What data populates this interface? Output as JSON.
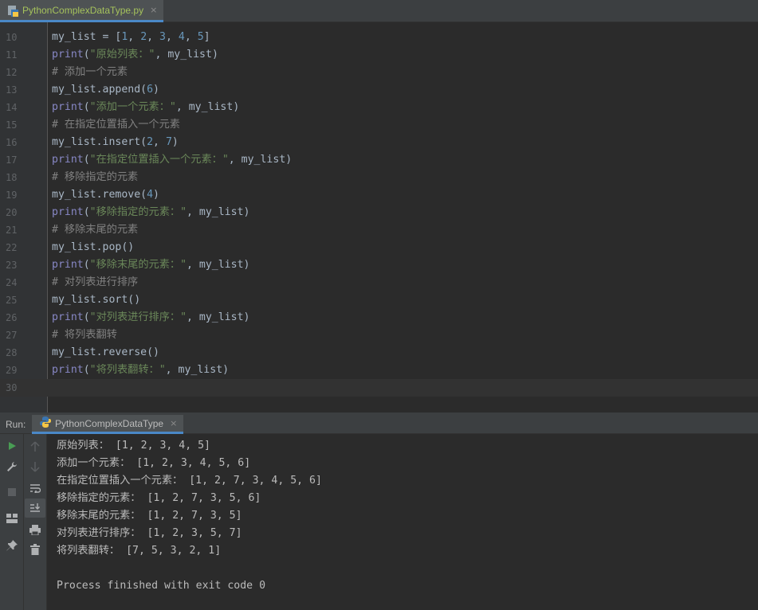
{
  "editor_tab": {
    "label": "PythonComplexDataType.py",
    "close": "×"
  },
  "code_lines": [
    {
      "num": "10",
      "tokens": [
        [
          "t",
          "my_list = ["
        ],
        [
          "n",
          "1"
        ],
        [
          "t",
          ", "
        ],
        [
          "n",
          "2"
        ],
        [
          "t",
          ", "
        ],
        [
          "n",
          "3"
        ],
        [
          "t",
          ", "
        ],
        [
          "n",
          "4"
        ],
        [
          "t",
          ", "
        ],
        [
          "n",
          "5"
        ],
        [
          "t",
          "]"
        ]
      ]
    },
    {
      "num": "11",
      "tokens": [
        [
          "k",
          "print"
        ],
        [
          "t",
          "("
        ],
        [
          "s",
          "\"原始列表：\""
        ],
        [
          "t",
          ", my_list)"
        ]
      ]
    },
    {
      "num": "12",
      "tokens": [
        [
          "c",
          "# 添加一个元素"
        ]
      ]
    },
    {
      "num": "13",
      "tokens": [
        [
          "t",
          "my_list.append("
        ],
        [
          "n",
          "6"
        ],
        [
          "t",
          ")"
        ]
      ]
    },
    {
      "num": "14",
      "tokens": [
        [
          "k",
          "print"
        ],
        [
          "t",
          "("
        ],
        [
          "s",
          "\"添加一个元素：\""
        ],
        [
          "t",
          ", my_list)"
        ]
      ]
    },
    {
      "num": "15",
      "tokens": [
        [
          "c",
          "# 在指定位置插入一个元素"
        ]
      ]
    },
    {
      "num": "16",
      "tokens": [
        [
          "t",
          "my_list.insert("
        ],
        [
          "n",
          "2"
        ],
        [
          "t",
          ", "
        ],
        [
          "n",
          "7"
        ],
        [
          "t",
          ")"
        ]
      ]
    },
    {
      "num": "17",
      "tokens": [
        [
          "k",
          "print"
        ],
        [
          "t",
          "("
        ],
        [
          "s",
          "\"在指定位置插入一个元素：\""
        ],
        [
          "t",
          ", my_list)"
        ]
      ]
    },
    {
      "num": "18",
      "tokens": [
        [
          "c",
          "# 移除指定的元素"
        ]
      ]
    },
    {
      "num": "19",
      "tokens": [
        [
          "t",
          "my_list.remove("
        ],
        [
          "n",
          "4"
        ],
        [
          "t",
          ")"
        ]
      ]
    },
    {
      "num": "20",
      "tokens": [
        [
          "k",
          "print"
        ],
        [
          "t",
          "("
        ],
        [
          "s",
          "\"移除指定的元素：\""
        ],
        [
          "t",
          ", my_list)"
        ]
      ]
    },
    {
      "num": "21",
      "tokens": [
        [
          "c",
          "# 移除末尾的元素"
        ]
      ]
    },
    {
      "num": "22",
      "tokens": [
        [
          "t",
          "my_list.pop()"
        ]
      ]
    },
    {
      "num": "23",
      "tokens": [
        [
          "k",
          "print"
        ],
        [
          "t",
          "("
        ],
        [
          "s",
          "\"移除末尾的元素：\""
        ],
        [
          "t",
          ", my_list)"
        ]
      ]
    },
    {
      "num": "24",
      "tokens": [
        [
          "c",
          "# 对列表进行排序"
        ]
      ]
    },
    {
      "num": "25",
      "tokens": [
        [
          "t",
          "my_list.sort()"
        ]
      ]
    },
    {
      "num": "26",
      "tokens": [
        [
          "k",
          "print"
        ],
        [
          "t",
          "("
        ],
        [
          "s",
          "\"对列表进行排序：\""
        ],
        [
          "t",
          ", my_list)"
        ]
      ]
    },
    {
      "num": "27",
      "tokens": [
        [
          "c",
          "# 将列表翻转"
        ]
      ]
    },
    {
      "num": "28",
      "tokens": [
        [
          "t",
          "my_list.reverse()"
        ]
      ]
    },
    {
      "num": "29",
      "tokens": [
        [
          "k",
          "print"
        ],
        [
          "t",
          "("
        ],
        [
          "s",
          "\"将列表翻转：\""
        ],
        [
          "t",
          ", my_list)"
        ]
      ]
    },
    {
      "num": "30",
      "tokens": [],
      "current": true
    }
  ],
  "run_panel": {
    "label": "Run:",
    "tab_label": "PythonComplexDataType",
    "tab_close": "×",
    "output_lines": [
      "原始列表： [1, 2, 3, 4, 5]",
      "添加一个元素： [1, 2, 3, 4, 5, 6]",
      "在指定位置插入一个元素： [1, 2, 7, 3, 4, 5, 6]",
      "移除指定的元素： [1, 2, 7, 3, 5, 6]",
      "移除末尾的元素： [1, 2, 7, 3, 5]",
      "对列表进行排序： [1, 2, 3, 5, 7]",
      "将列表翻转： [7, 5, 3, 2, 1]",
      "",
      "Process finished with exit code 0"
    ]
  },
  "toolbar_left": [
    "run-icon",
    "wrench-icon",
    "stop-icon",
    "layout-icon",
    "pin-icon"
  ],
  "toolbar_right": [
    "arrow-up-icon",
    "arrow-down-icon",
    "soft-wrap-icon",
    "scroll-to-end-icon",
    "print-icon",
    "trash-icon"
  ],
  "colors": {
    "background": "#2b2b2b",
    "keyword": "#8888c6",
    "string": "#6a8759",
    "number": "#6897bb",
    "comment": "#808080",
    "text": "#a9b7c6",
    "accent": "#4a88c7",
    "run_green": "#499c54"
  }
}
